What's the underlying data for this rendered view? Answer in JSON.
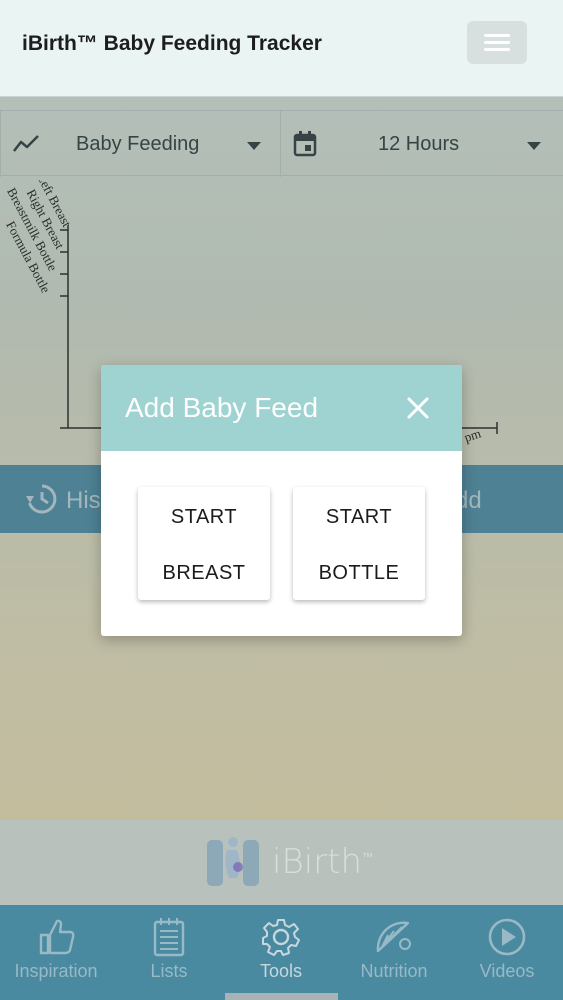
{
  "header": {
    "title": "iBirth™ Baby Feeding Tracker",
    "menu_icon": "hamburger-icon"
  },
  "filters": {
    "type": {
      "icon": "trend-line-icon",
      "label": "Baby Feeding"
    },
    "range": {
      "icon": "calendar-icon",
      "label": "12 Hours"
    }
  },
  "chart_data": {
    "type": "scatter",
    "y_categories": [
      "Left Breast",
      "Right Breast",
      "Breastmilk Bottle",
      "Formula Bottle"
    ],
    "x_tick_partial": "pm",
    "series": []
  },
  "action_bar": {
    "history_label": "His",
    "add_label": "dd"
  },
  "modal": {
    "title": "Add Baby Feed",
    "close_icon": "close-icon",
    "buttons": [
      {
        "line1": "START",
        "line2": "BREAST"
      },
      {
        "line1": "START",
        "line2": "BOTTLE"
      }
    ]
  },
  "brand": {
    "name": "iBirth",
    "mark": "™"
  },
  "nav": {
    "items": [
      {
        "label": "Inspiration",
        "icon": "thumbs-up-icon"
      },
      {
        "label": "Lists",
        "icon": "notepad-icon"
      },
      {
        "label": "Tools",
        "icon": "gear-icon"
      },
      {
        "label": "Nutrition",
        "icon": "citrus-icon"
      },
      {
        "label": "Videos",
        "icon": "play-icon"
      }
    ],
    "active_index": 2
  },
  "colors": {
    "header_bg": "#eaf4f2",
    "accent": "#4a8aa0",
    "modal_header": "#9ed3d1"
  }
}
